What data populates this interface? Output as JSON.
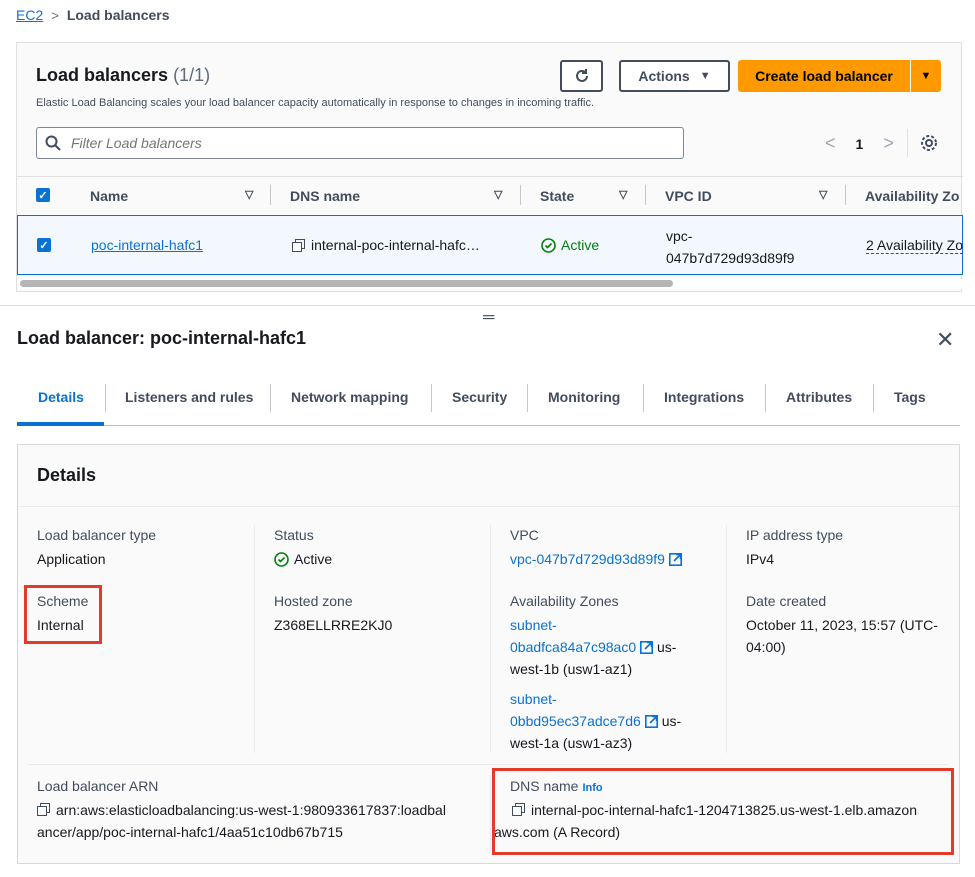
{
  "breadcrumb": {
    "root": "EC2",
    "current": "Load balancers"
  },
  "list": {
    "title": "Load balancers",
    "count": "(1/1)",
    "description": "Elastic Load Balancing scales your load balancer capacity automatically in response to changes in incoming traffic.",
    "actions_label": "Actions",
    "create_label": "Create load balancer",
    "filter_placeholder": "Filter Load balancers",
    "page": "1",
    "columns": [
      "Name",
      "DNS name",
      "State",
      "VPC ID",
      "Availability Zo"
    ],
    "row": {
      "name": "poc-internal-hafc1",
      "dns": "internal-poc-internal-hafc…",
      "state": "Active",
      "vpc_line1": "vpc-",
      "vpc_line2": "047b7d729d93d89f9",
      "az": "2 Availability Zo"
    }
  },
  "detail": {
    "title": "Load balancer: poc-internal-hafc1",
    "tabs": [
      "Details",
      "Listeners and rules",
      "Network mapping",
      "Security",
      "Monitoring",
      "Integrations",
      "Attributes",
      "Tags"
    ],
    "section_title": "Details",
    "lb_type_label": "Load balancer type",
    "lb_type_value": "Application",
    "scheme_label": "Scheme",
    "scheme_value": "Internal",
    "status_label": "Status",
    "status_value": "Active",
    "hosted_zone_label": "Hosted zone",
    "hosted_zone_value": "Z368ELLRRE2KJ0",
    "vpc_label": "VPC",
    "vpc_value": "vpc-047b7d729d93d89f9",
    "az_label": "Availability Zones",
    "az1_link_a": "subnet-",
    "az1_link_b": "0badfca84a7c98ac0",
    "az1_suffix_a": "us-",
    "az1_suffix_b": "west-1b (usw1-az1)",
    "az2_link_a": "subnet-",
    "az2_link_b": "0bbd95ec37adce7d6",
    "az2_suffix_a": "us-",
    "az2_suffix_b": "west-1a (usw1-az3)",
    "ip_type_label": "IP address type",
    "ip_type_value": "IPv4",
    "date_label": "Date created",
    "date_value_1": "October 11, 2023, 15:57 (UTC-",
    "date_value_2": "04:00)",
    "arn_label": "Load balancer ARN",
    "arn_line1": "arn:aws:elasticloadbalancing:us-west-1:980933617837:loadbal",
    "arn_line2": "ancer/app/poc-internal-hafc1/4aa51c10db67b715",
    "dns_label": "DNS name",
    "dns_info": "Info",
    "dns_line1": "internal-poc-internal-hafc1-1204713825.us-west-1.elb.amazon",
    "dns_line2": "aws.com (A Record)"
  },
  "colors": {
    "accent": "#0972d3",
    "primary_button": "#ff9900",
    "success": "#037f0c",
    "highlight": "#e23b2a"
  }
}
